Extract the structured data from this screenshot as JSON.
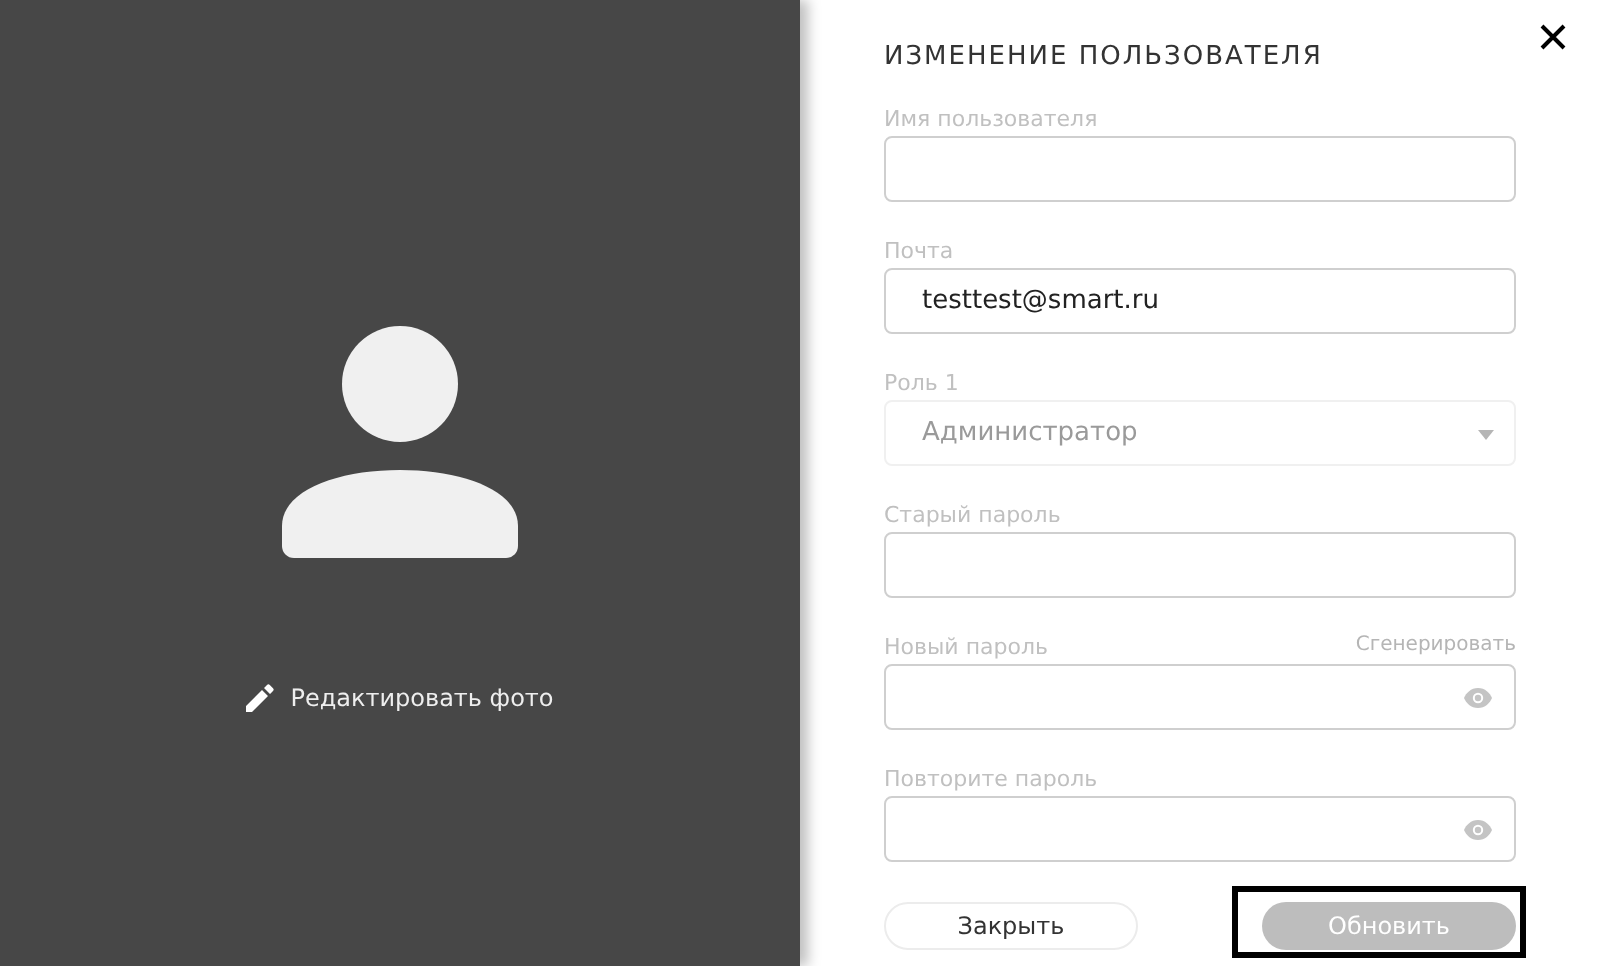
{
  "photo_panel": {
    "edit_link": "Редактировать фото"
  },
  "form": {
    "title": "ИЗМЕНЕНИЕ ПОЛЬЗОВАТЕЛЯ",
    "fields": [
      {
        "kind": "text",
        "label": "Имя пользователя"
      },
      {
        "kind": "text",
        "label": "Почта",
        "value": "testtest@smart.ru"
      },
      {
        "kind": "select",
        "label": "Роль 1",
        "value": "Администратор"
      },
      {
        "kind": "password",
        "label": "Старый пароль"
      },
      {
        "kind": "password-reveal",
        "label": "Новый пароль",
        "action": "Сгенерировать"
      },
      {
        "kind": "password-reveal",
        "label": "Повторите пароль"
      }
    ],
    "buttons": [
      {
        "label": "Закрыть",
        "kind": "secondary",
        "focused": false
      },
      {
        "label": "Обновить",
        "kind": "primary",
        "focused": true
      }
    ]
  }
}
